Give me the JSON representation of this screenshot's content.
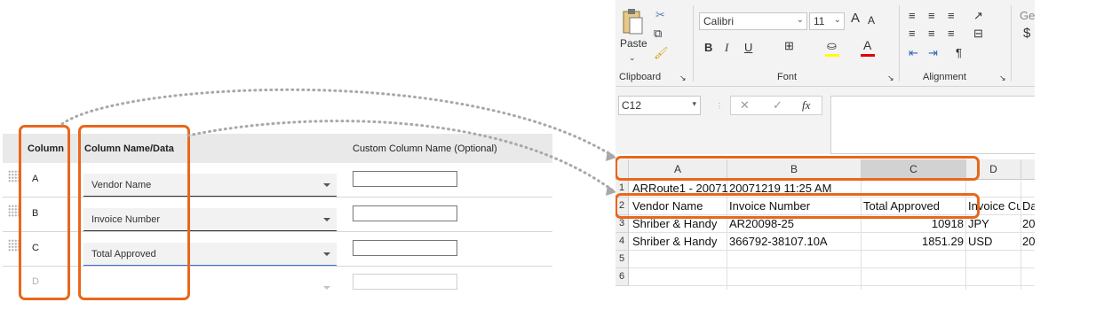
{
  "mapper": {
    "headers": {
      "column": "Column",
      "column_name": "Column Name/Data",
      "custom": "Custom Column Name (Optional)"
    },
    "rows": [
      {
        "letter": "A",
        "selected": "Vendor Name"
      },
      {
        "letter": "B",
        "selected": "Invoice Number"
      },
      {
        "letter": "C",
        "selected": "Total Approved"
      },
      {
        "letter": "D",
        "selected": ""
      }
    ]
  },
  "excel": {
    "ribbon": {
      "clipboard": {
        "paste": "Paste",
        "group_label": "Clipboard"
      },
      "font": {
        "name": "Calibri",
        "size": "11",
        "bold": "B",
        "italic": "I",
        "underline": "U",
        "font_color": "A",
        "grow": "A",
        "shrink": "A",
        "group_label": "Font"
      },
      "alignment": {
        "group_label": "Alignment"
      },
      "number": {
        "partial": "Ge",
        "currency": "$"
      }
    },
    "name_box": "C12",
    "fx": "fx",
    "columns": [
      "A",
      "B",
      "C",
      "D"
    ],
    "rows": [
      {
        "num": "1",
        "cells": [
          "ARRoute1 - 20071",
          "20071219 11:25 AM",
          "",
          ""
        ]
      },
      {
        "num": "2",
        "cells": [
          "Vendor Name",
          "Invoice Number",
          "Total Approved",
          "Invoice Cu",
          "Da"
        ]
      },
      {
        "num": "3",
        "cells": [
          "Shriber & Handy",
          "AR20098-25",
          "10918",
          "JPY",
          "20"
        ]
      },
      {
        "num": "4",
        "cells": [
          "Shriber & Handy",
          "366792-38107.10A",
          "1851.29",
          "USD",
          "20"
        ]
      },
      {
        "num": "5",
        "cells": [
          "",
          "",
          "",
          "",
          ""
        ]
      },
      {
        "num": "6",
        "cells": [
          "",
          "",
          "",
          "",
          ""
        ]
      }
    ]
  },
  "colors": {
    "callout": "#e8671c",
    "excel_green": "#217346"
  }
}
